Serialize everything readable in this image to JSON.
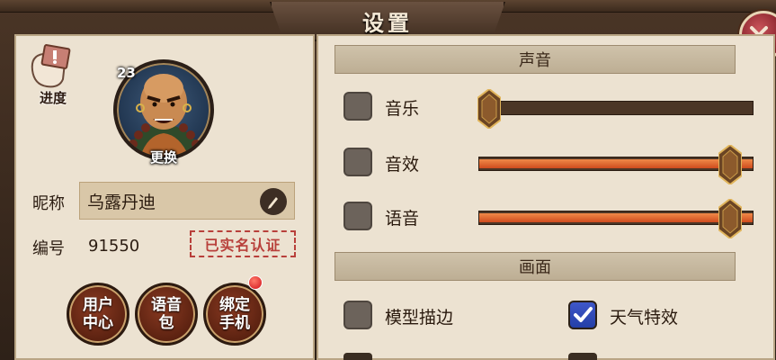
{
  "window": {
    "title": "设置"
  },
  "left": {
    "progress_label": "进度",
    "level": "23",
    "change_avatar_label": "更换",
    "nickname_label": "昵称",
    "nickname_value": "乌露丹迪",
    "id_label": "编号",
    "id_value": "91550",
    "verified_label": "已实名认证",
    "buttons": [
      {
        "label": "用户中心"
      },
      {
        "label": "语音包"
      },
      {
        "label": "绑定手机",
        "has_notification": true
      }
    ]
  },
  "right": {
    "sound_section": "声音",
    "sliders": [
      {
        "label": "音乐",
        "checked": false,
        "level": 0.0
      },
      {
        "label": "音效",
        "checked": false,
        "level": 1.0
      },
      {
        "label": "语音",
        "checked": false,
        "level": 1.0
      }
    ],
    "graphics_section": "画面",
    "graphics_options": [
      {
        "label": "模型描边",
        "checked": false
      },
      {
        "label": "天气特效",
        "checked": true
      }
    ]
  },
  "colors": {
    "panel_bg": "#ece2d1",
    "slider_fill": "#e06a32",
    "checkbox_checked": "#3450c0",
    "close_button": "#a53038",
    "stamp_red": "#b8403b"
  }
}
